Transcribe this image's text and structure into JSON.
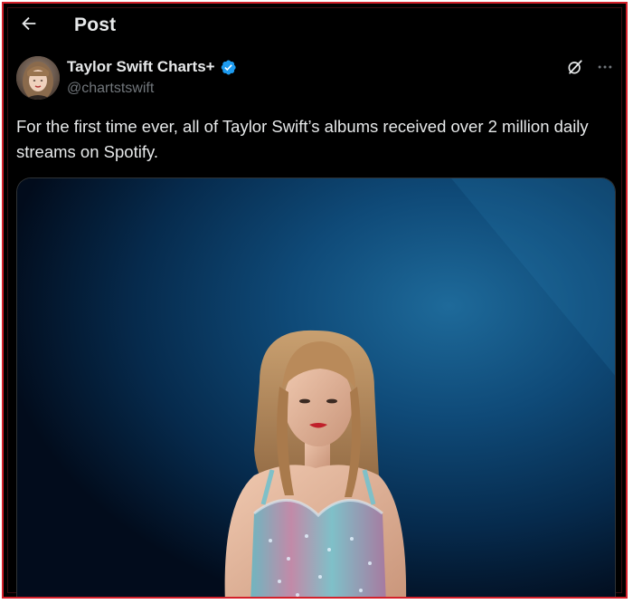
{
  "header": {
    "back_icon": "arrow-left-icon",
    "title": "Post"
  },
  "author": {
    "name": "Taylor Swift Charts+",
    "handle": "@chartstswift",
    "verified_icon": "verified-badge-icon",
    "verified_color": "#1d9bf0"
  },
  "actions": {
    "grok_icon": "grok-icon",
    "more_icon": "more-horizontal-icon"
  },
  "post": {
    "text": "For the first time ever, all of Taylor Swift’s albums received over 2 million daily streams on Spotify."
  },
  "colors": {
    "background": "#000000",
    "text_primary": "#e7e9ea",
    "text_secondary": "#71767b",
    "frame_border": "#d4202a"
  }
}
